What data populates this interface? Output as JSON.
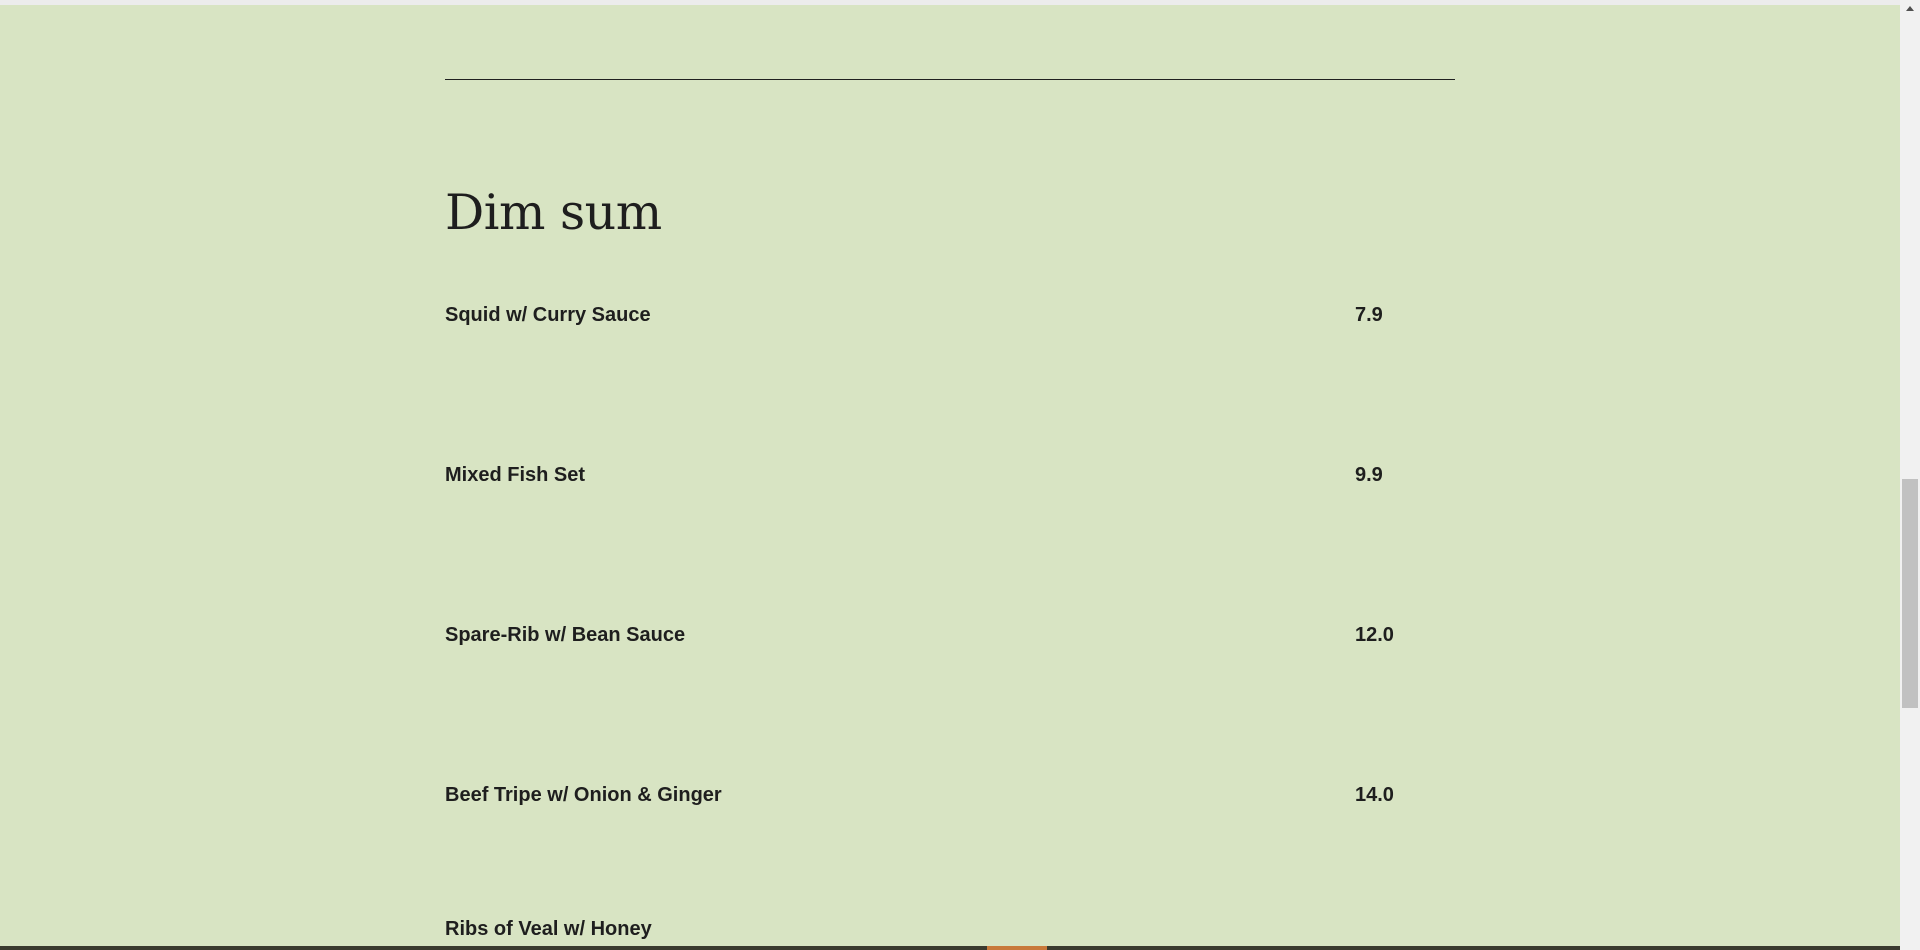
{
  "section": {
    "title": "Dim sum"
  },
  "menu_items": [
    {
      "name": "Squid w/ Curry Sauce",
      "price": "7.9"
    },
    {
      "name": "Mixed Fish Set",
      "price": "9.9"
    },
    {
      "name": "Spare-Rib w/ Bean Sauce",
      "price": "12.0"
    },
    {
      "name": "Beef Tripe w/ Onion & Ginger",
      "price": "14.0"
    },
    {
      "name": "Ribs of Veal w/ Honey",
      "price": ""
    }
  ],
  "colors": {
    "page_background": "#d8e4c3",
    "text": "#1e1e1e",
    "divider": "#202020",
    "scrollbar_thumb": "#c1c1c1"
  },
  "icons": {
    "scroll_up": "scroll-up-arrow-icon"
  }
}
